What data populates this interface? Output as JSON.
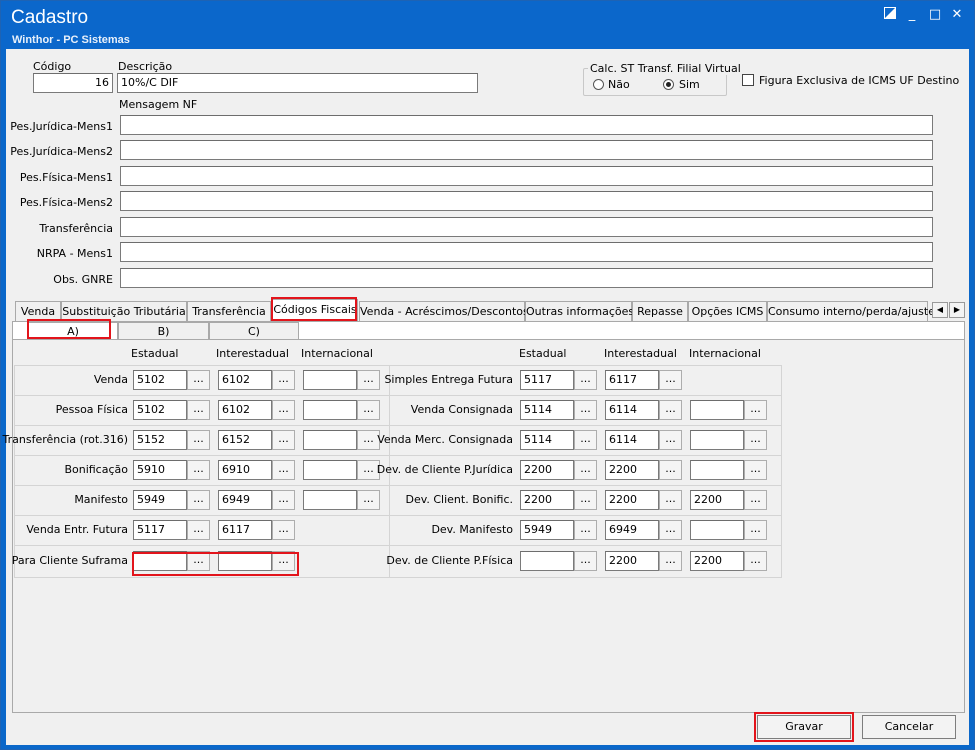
{
  "window": {
    "title": "Cadastro",
    "subtitle": "Winthor - PC Sistemas",
    "restore_icon": "restore-icon",
    "minimize_glyph": "_",
    "maximize_glyph": "□",
    "close_glyph": "✕"
  },
  "header": {
    "codigo_label": "Código",
    "codigo_value": "16",
    "descricao_label": "Descrição",
    "descricao_value": "10%/C DIF",
    "calc_group_label": "Calc. ST Transf. Filial Virtual",
    "radio_nao": "Não",
    "radio_sim": "Sim",
    "radio_selected": "Sim",
    "figura_label": "Figura Exclusiva de ICMS UF Destino",
    "mensagem_label": "Mensagem NF"
  },
  "messages": [
    {
      "label": "Pes.Jurídica-Mens1",
      "value": ""
    },
    {
      "label": "Pes.Jurídica-Mens2",
      "value": ""
    },
    {
      "label": "Pes.Física-Mens1",
      "value": ""
    },
    {
      "label": "Pes.Física-Mens2",
      "value": ""
    },
    {
      "label": "Transferência",
      "value": ""
    },
    {
      "label": "NRPA - Mens1",
      "value": ""
    },
    {
      "label": "Obs. GNRE",
      "value": ""
    }
  ],
  "tabs": [
    "Venda",
    "Substituição Tributária",
    "Transferência",
    "Códigos Fiscais",
    "Venda - Acréscimos/Descontos",
    "Outras informações",
    "Repasse",
    "Opções ICMS",
    "Consumo interno/perda/ajuste"
  ],
  "active_tab": "Códigos Fiscais",
  "scroll_left": "◀",
  "scroll_right": "▶",
  "subtabs": [
    "A)",
    "B)",
    "C)"
  ],
  "active_subtab": "A)",
  "columns": {
    "estadual": "Estadual",
    "interestadual": "Interestadual",
    "internacional": "Internacional"
  },
  "dots_label": "...",
  "left_rows": [
    {
      "label": "Venda",
      "estadual": "5102",
      "interestadual": "6102",
      "internacional": ""
    },
    {
      "label": "Pessoa Física",
      "estadual": "5102",
      "interestadual": "6102",
      "internacional": ""
    },
    {
      "label": "Transferência (rot.316)",
      "estadual": "5152",
      "interestadual": "6152",
      "internacional": ""
    },
    {
      "label": "Bonificação",
      "estadual": "5910",
      "interestadual": "6910",
      "internacional": ""
    },
    {
      "label": "Manifesto",
      "estadual": "5949",
      "interestadual": "6949",
      "internacional": ""
    },
    {
      "label": "Venda Entr. Futura",
      "estadual": "5117",
      "interestadual": "6117"
    },
    {
      "label": "Para Cliente Suframa",
      "estadual": "",
      "interestadual": ""
    }
  ],
  "right_rows": [
    {
      "label": "Simples Entrega Futura",
      "estadual": "5117",
      "interestadual": "6117"
    },
    {
      "label": "Venda Consignada",
      "estadual": "5114",
      "interestadual": "6114",
      "internacional": ""
    },
    {
      "label": "Venda Merc. Consignada",
      "estadual": "5114",
      "interestadual": "6114",
      "internacional": ""
    },
    {
      "label": "Dev. de Cliente P.Jurídica",
      "estadual": "2200",
      "interestadual": "2200",
      "internacional": ""
    },
    {
      "label": "Dev. Client. Bonific.",
      "estadual": "2200",
      "interestadual": "2200",
      "internacional": "2200"
    },
    {
      "label": "Dev. Manifesto",
      "estadual": "5949",
      "interestadual": "6949",
      "internacional": ""
    },
    {
      "label": "Dev. de Cliente P.Física",
      "estadual": "",
      "interestadual": "2200",
      "internacional": "2200"
    }
  ],
  "footer": {
    "gravar_label": "Gravar",
    "cancelar_label": "Cancelar"
  }
}
